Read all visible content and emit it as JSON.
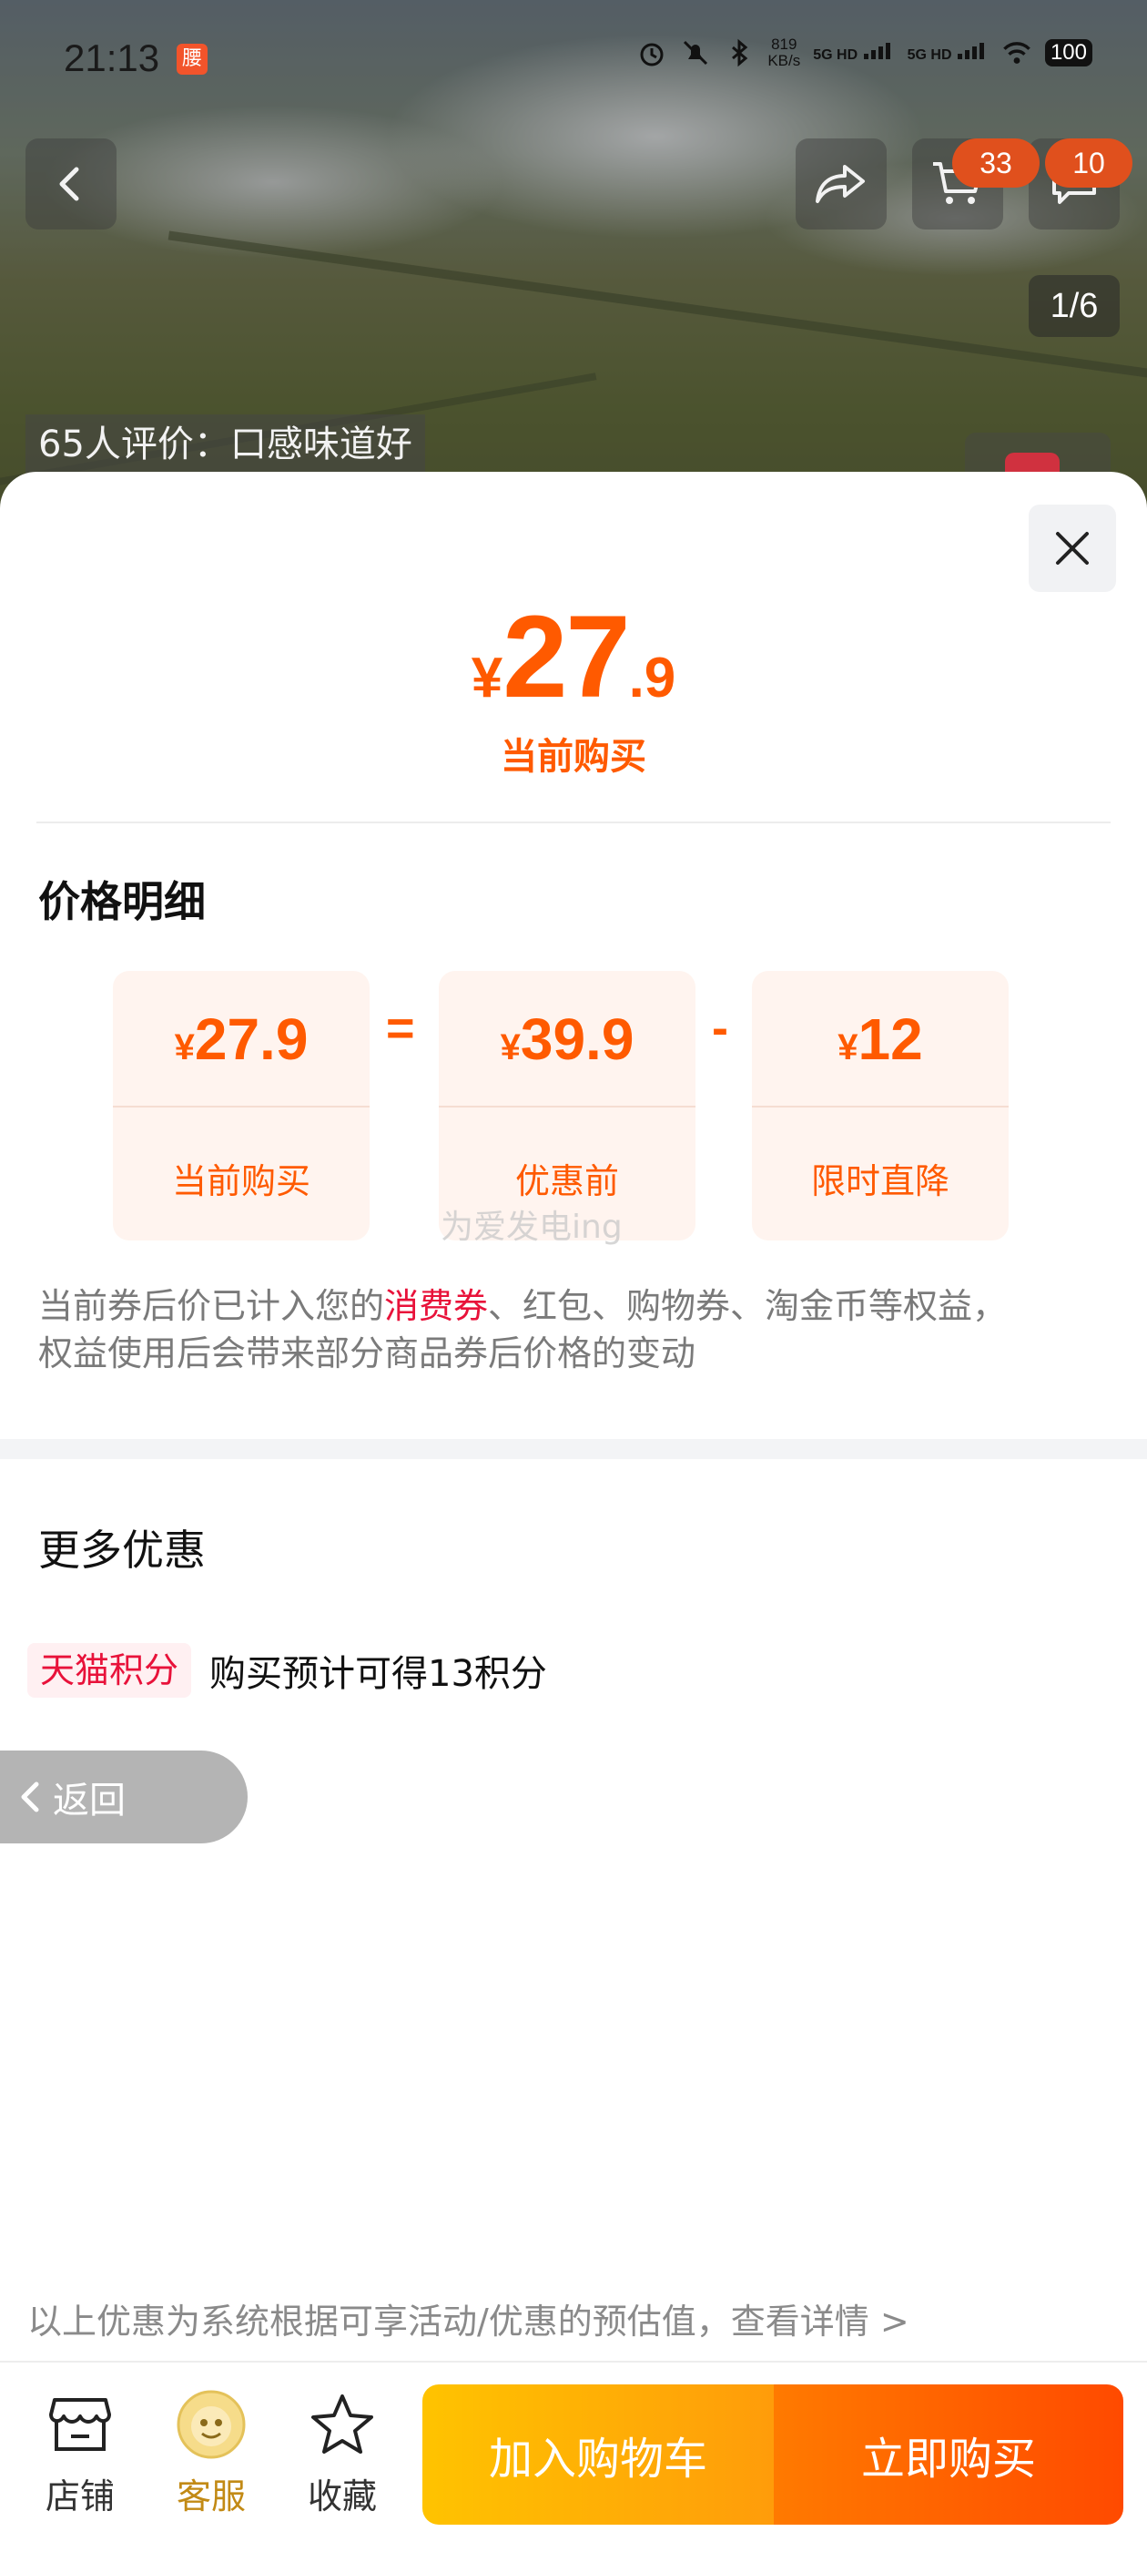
{
  "status_bar": {
    "time": "21:13",
    "app_badge": "腰",
    "net_speed_value": "819",
    "net_speed_unit": "KB/s",
    "signal_1": "5G HD",
    "signal_2": "5G HD",
    "battery": "100"
  },
  "header": {
    "cart_count": "33",
    "message_count": "10",
    "pager": "1/6",
    "review_tag": "65人评价：口感味道好"
  },
  "sheet": {
    "price": {
      "currency": "¥",
      "integer": "27",
      "decimal": ".9"
    },
    "price_caption": "当前购买",
    "breakdown_title": "价格明细",
    "breakdown": [
      {
        "currency": "¥",
        "amount": "27.9",
        "label": "当前购买"
      },
      {
        "currency": "¥",
        "amount": "39.9",
        "label": "优惠前"
      },
      {
        "currency": "¥",
        "amount": "12",
        "label": "限时直降"
      }
    ],
    "op_equals": "=",
    "op_minus": "-",
    "watermark": "为爱发电ing",
    "note_part1": "当前券后价已计入您的",
    "note_highlight": "消费券",
    "note_part2": "、红包、购物券、淘金币等权益，",
    "note_line2": "权益使用后会带来部分商品券后价格的变动",
    "more_title": "更多优惠",
    "reward_tag": "天猫积分",
    "reward_text": "购买预计可得13积分",
    "back_label": "返回",
    "disclaimer": "以上优惠为系统根据可享活动/优惠的预估值，查看详情 >"
  },
  "bottom_bar": {
    "tabs": [
      {
        "label": "店铺",
        "icon": "store-icon"
      },
      {
        "label": "客服",
        "icon": "customer-service-icon"
      },
      {
        "label": "收藏",
        "icon": "star-icon"
      }
    ],
    "add_to_cart": "加入购物车",
    "buy_now": "立即购买"
  },
  "colors": {
    "accent": "#ff5a00",
    "highlight": "#e8123a",
    "cart_button": "#ffb000",
    "buy_button": "#ff5a00"
  }
}
